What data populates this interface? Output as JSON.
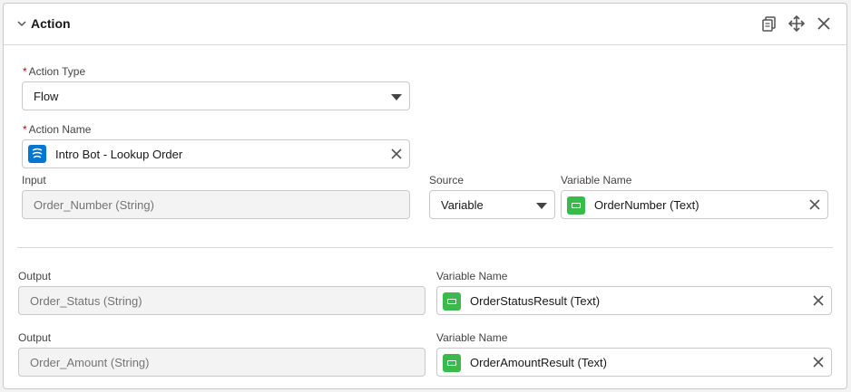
{
  "section": {
    "title": "Action"
  },
  "action_type": {
    "label": "Action Type",
    "required": "*",
    "value": "Flow"
  },
  "action_name": {
    "label": "Action Name",
    "required": "*",
    "value": "Intro Bot - Lookup Order"
  },
  "input": {
    "label": "Input",
    "value": "Order_Number (String)",
    "source_label": "Source",
    "source_value": "Variable",
    "variable_label": "Variable Name",
    "variable_value": "OrderNumber (Text)"
  },
  "outputs": [
    {
      "label": "Output",
      "value": "Order_Status (String)",
      "variable_label": "Variable Name",
      "variable_value": "OrderStatusResult (Text)"
    },
    {
      "label": "Output",
      "value": "Order_Amount (String)",
      "variable_label": "Variable Name",
      "variable_value": "OrderAmountResult (Text)"
    }
  ],
  "colors": {
    "variable_icon": "#3bba4c",
    "flow_icon": "#0176d3",
    "required": "#ba0517"
  },
  "icons": [
    "chevron-down-icon",
    "copy-icon",
    "move-icon",
    "close-icon",
    "flow-icon",
    "variable-icon",
    "clear-icon",
    "dropdown-caret-icon"
  ]
}
